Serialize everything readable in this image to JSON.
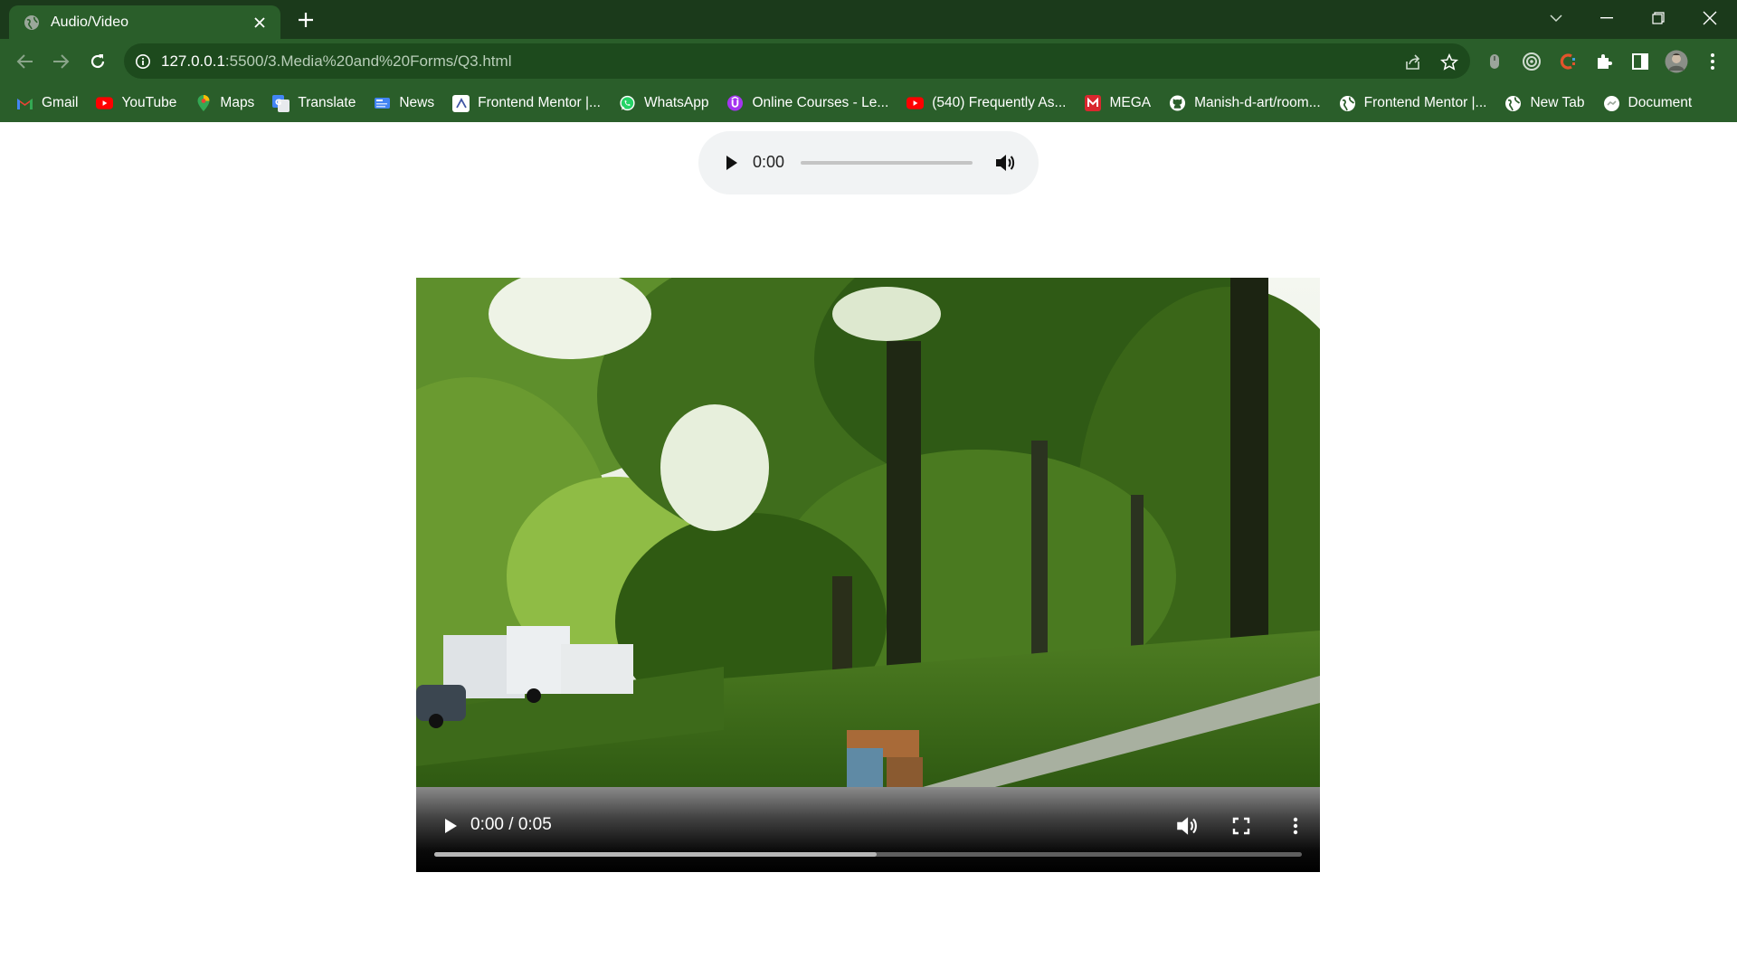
{
  "tab": {
    "title": "Audio/Video"
  },
  "address": {
    "host": "127.0.0.1",
    "path": ":5500/3.Media%20and%20Forms/Q3.html"
  },
  "bookmarks": [
    {
      "label": "Gmail",
      "icon": "gmail-icon"
    },
    {
      "label": "YouTube",
      "icon": "youtube-icon"
    },
    {
      "label": "Maps",
      "icon": "maps-icon"
    },
    {
      "label": "Translate",
      "icon": "translate-icon"
    },
    {
      "label": "News",
      "icon": "news-icon"
    },
    {
      "label": "Frontend Mentor |...",
      "icon": "frontend-mentor-icon"
    },
    {
      "label": "WhatsApp",
      "icon": "whatsapp-icon"
    },
    {
      "label": "Online Courses - Le...",
      "icon": "udemy-icon"
    },
    {
      "label": "(540) Frequently As...",
      "icon": "youtube-icon"
    },
    {
      "label": "MEGA",
      "icon": "mega-icon"
    },
    {
      "label": "Manish-d-art/room...",
      "icon": "github-icon"
    },
    {
      "label": "Frontend Mentor |...",
      "icon": "globe-icon"
    },
    {
      "label": "New Tab",
      "icon": "globe-icon"
    },
    {
      "label": "Document",
      "icon": "document-icon"
    }
  ],
  "audio": {
    "time": "0:00",
    "progress": 0
  },
  "video": {
    "time": "0:00 / 0:05",
    "buffered": 0.51
  },
  "colors": {
    "chrome_dark": "#1b3a1b",
    "chrome": "#2a5e2a",
    "omnibox": "#1d4a1d"
  }
}
